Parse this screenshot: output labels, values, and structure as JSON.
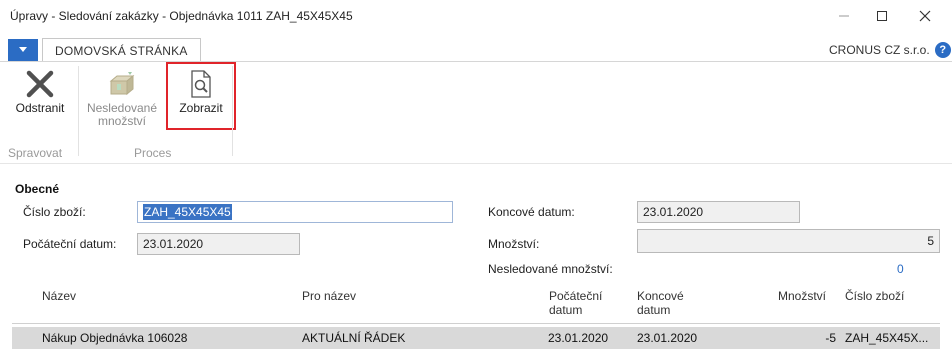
{
  "window": {
    "title": "Úpravy - Sledování zakázky - Objednávka 1011 ZAH_45X45X45",
    "minimize_icon": "minimize-icon",
    "maximize_icon": "maximize-icon",
    "close_icon": "close-icon"
  },
  "ribbon": {
    "tab_home": "DOMOVSKÁ STRÁNKA",
    "company": "CRONUS CZ s.r.o.",
    "help_label": "?",
    "buttons": {
      "delete": "Odstranit",
      "untracked_line1": "Nesledované",
      "untracked_line2": "množství",
      "show": "Zobrazit"
    },
    "groups": {
      "manage": "Spravovat",
      "process": "Proces"
    }
  },
  "general": {
    "title": "Obecné",
    "item_no_label": "Číslo zboží:",
    "item_no_value": "ZAH_45X45X45",
    "start_date_label": "Počáteční datum:",
    "start_date_value": "23.01.2020",
    "end_date_label": "Koncové datum:",
    "end_date_value": "23.01.2020",
    "quantity_label": "Množství:",
    "quantity_value": "5",
    "untracked_qty_label": "Nesledované množství:",
    "untracked_qty_value": "0"
  },
  "lines": {
    "headers": {
      "name": "Název",
      "for_name": "Pro název",
      "start_date_1": "Počáteční",
      "start_date_2": "datum",
      "end_date_1": "Koncové",
      "end_date_2": "datum",
      "quantity": "Množství",
      "item_no": "Číslo zboží"
    },
    "rows": [
      {
        "name": "Nákup Objednávka 106028",
        "for_name": "AKTUÁLNÍ ŘÁDEK",
        "start_date": "23.01.2020",
        "end_date": "23.01.2020",
        "quantity": "-5",
        "item_no": "ZAH_45X45X..."
      }
    ]
  },
  "colors": {
    "accent": "#2b6cc4",
    "highlight_border": "#e0242a",
    "row_selected": "#d9d9d9"
  }
}
